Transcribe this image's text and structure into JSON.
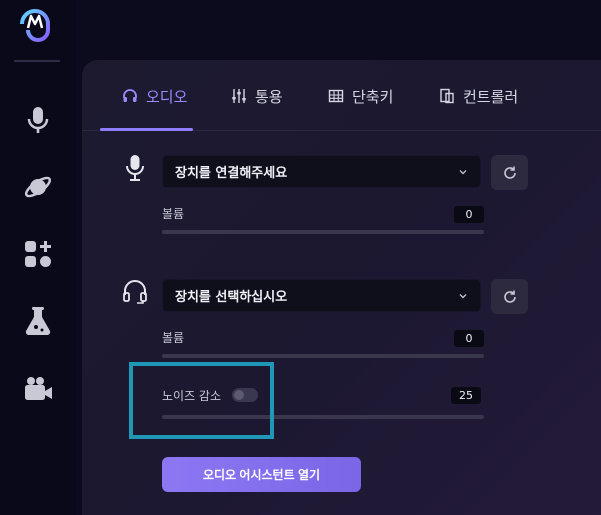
{
  "colors": {
    "accent": "#8f7dff",
    "highlight": "#1f98b8",
    "background": "#0b0b1d",
    "panel": "#1d1a30"
  },
  "sidebar": {
    "logo_icon": "app-logo-icon",
    "items": [
      {
        "name": "microphone",
        "icon": "microphone-icon"
      },
      {
        "name": "planet",
        "icon": "planet-icon"
      },
      {
        "name": "apps",
        "icon": "apps-add-icon"
      },
      {
        "name": "lab",
        "icon": "flask-icon"
      },
      {
        "name": "camera",
        "icon": "video-camera-icon"
      }
    ]
  },
  "tabs": [
    {
      "label": "오디오",
      "icon": "headset-icon",
      "active": true
    },
    {
      "label": "통용",
      "icon": "sliders-icon",
      "active": false
    },
    {
      "label": "단축키",
      "icon": "grid-icon",
      "active": false
    },
    {
      "label": "컨트롤러",
      "icon": "copy-icon",
      "active": false
    }
  ],
  "microphone": {
    "device_placeholder": "장치를 연결해주세요",
    "volume_label": "볼륨",
    "volume_value": "0",
    "volume_level": 0
  },
  "headset": {
    "device_placeholder": "장치를 선택하십시오",
    "volume_label": "볼륨",
    "volume_value": "0",
    "volume_level": 0
  },
  "noise_reduction": {
    "label": "노이즈 감소",
    "enabled": false,
    "value": "25",
    "level": 0
  },
  "assistant_button": "오디오 어시스턴트 열기"
}
